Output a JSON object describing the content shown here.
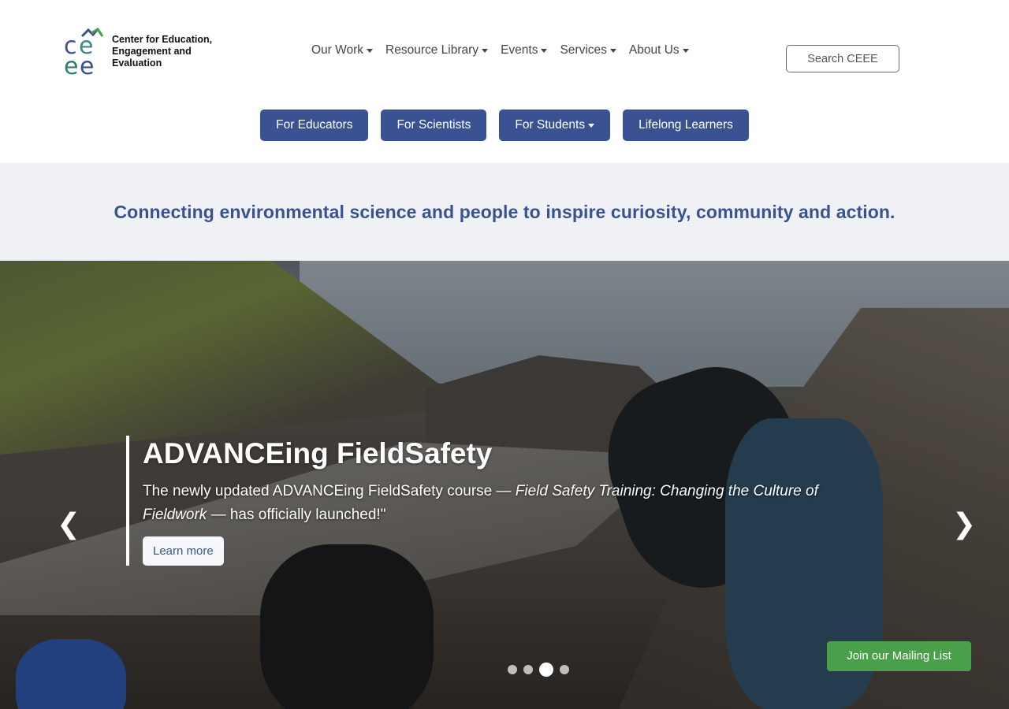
{
  "logo": {
    "mark_text": "ce ee",
    "line1": "Center for Education,",
    "line2": "Engagement and",
    "line3": "Evaluation"
  },
  "nav": {
    "items": [
      {
        "label": "Our Work"
      },
      {
        "label": "Resource Library"
      },
      {
        "label": "Events"
      },
      {
        "label": "Services"
      },
      {
        "label": "About Us"
      }
    ],
    "search_label": "Search CEEE"
  },
  "audience": {
    "buttons": [
      {
        "label": "For Educators"
      },
      {
        "label": "For Scientists"
      },
      {
        "label": "For Students"
      },
      {
        "label": "Lifelong Learners"
      }
    ]
  },
  "tagline": "Connecting environmental science and people to inspire curiosity, community and action.",
  "hero": {
    "title": "ADVANCEing FieldSafety",
    "body_part1": "The newly updated ADVANCEing FieldSafety course — ",
    "body_italic": "Field Safety Training: Changing the Culture of Fieldwork",
    "body_part2": " — has officially launched!\"",
    "learn_more": "Learn more",
    "prev": "❮",
    "next": "❯",
    "slide_count": 4,
    "active_slide": 3,
    "mailing_list": "Join our Mailing List"
  },
  "colors": {
    "brand_blue": "#3a5192",
    "green": "#4aa04a",
    "tagline_bg": "#f0f1f4"
  }
}
